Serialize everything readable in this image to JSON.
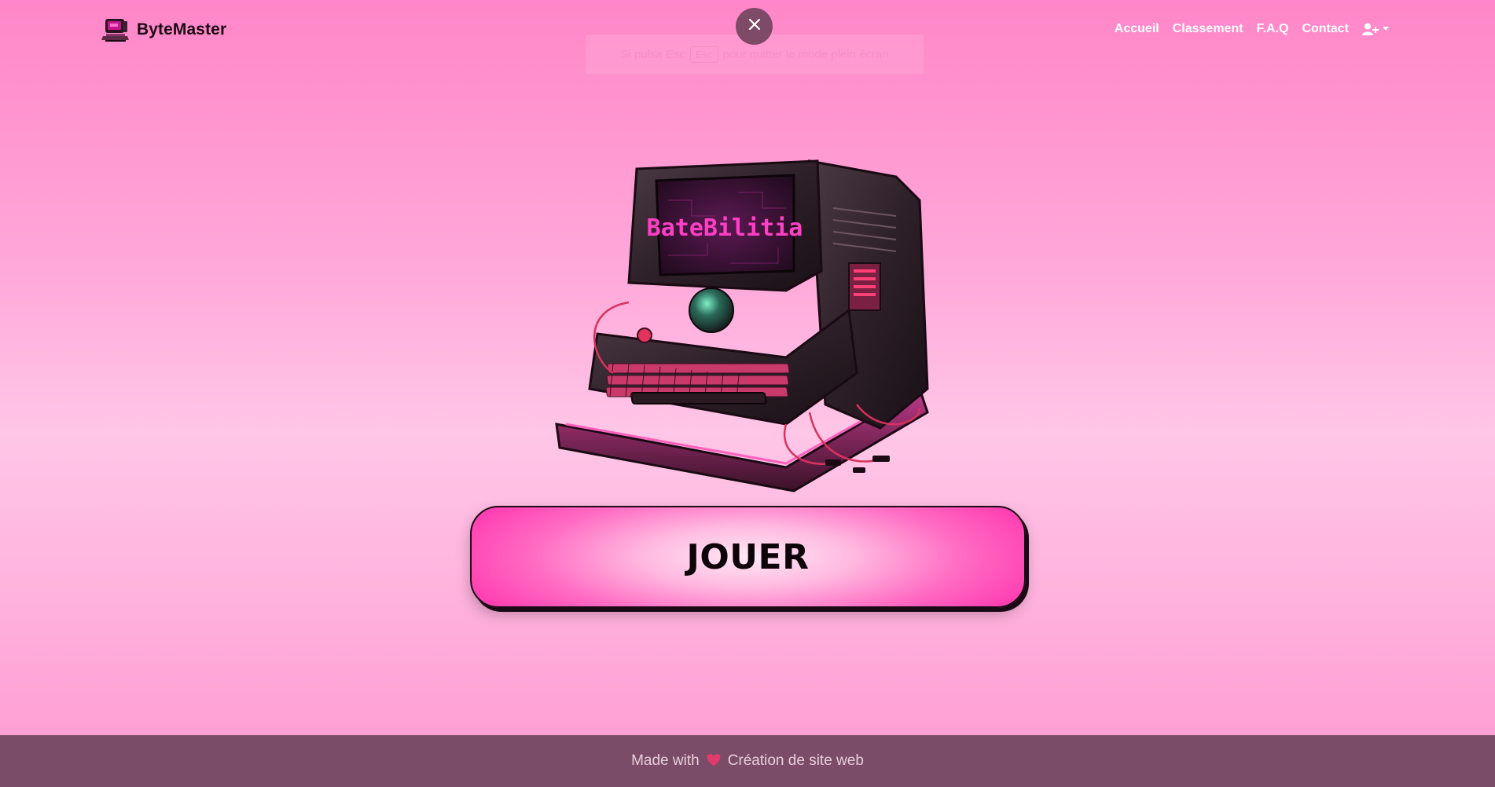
{
  "brand": {
    "name": "ByteMaster",
    "logo_icon": "retro-computer-icon"
  },
  "nav": {
    "links": [
      {
        "label": "Accueil"
      },
      {
        "label": "Classement"
      },
      {
        "label": "F.A.Q"
      },
      {
        "label": "Contact"
      }
    ],
    "user_menu_icon": "user-plus-icon"
  },
  "fullscreen_hint": {
    "text_before": "Si pulsa Esc",
    "key": "Esc",
    "text_after": "pour quitter le mode plein écran"
  },
  "hero": {
    "image_icon": "retro-computer-illustration",
    "screen_text": "BateBilitia"
  },
  "play_button": {
    "label": "JOUER"
  },
  "footer": {
    "made_with": "Made with",
    "heart_icon": "heart-icon",
    "link_text": "Création de site web"
  },
  "colors": {
    "background_top": "#ff86c8",
    "background_mid": "#ffc6e7",
    "footer": "#7b4c68",
    "button_pink": "#ff3eb2",
    "nav_text": "#ffffff"
  }
}
